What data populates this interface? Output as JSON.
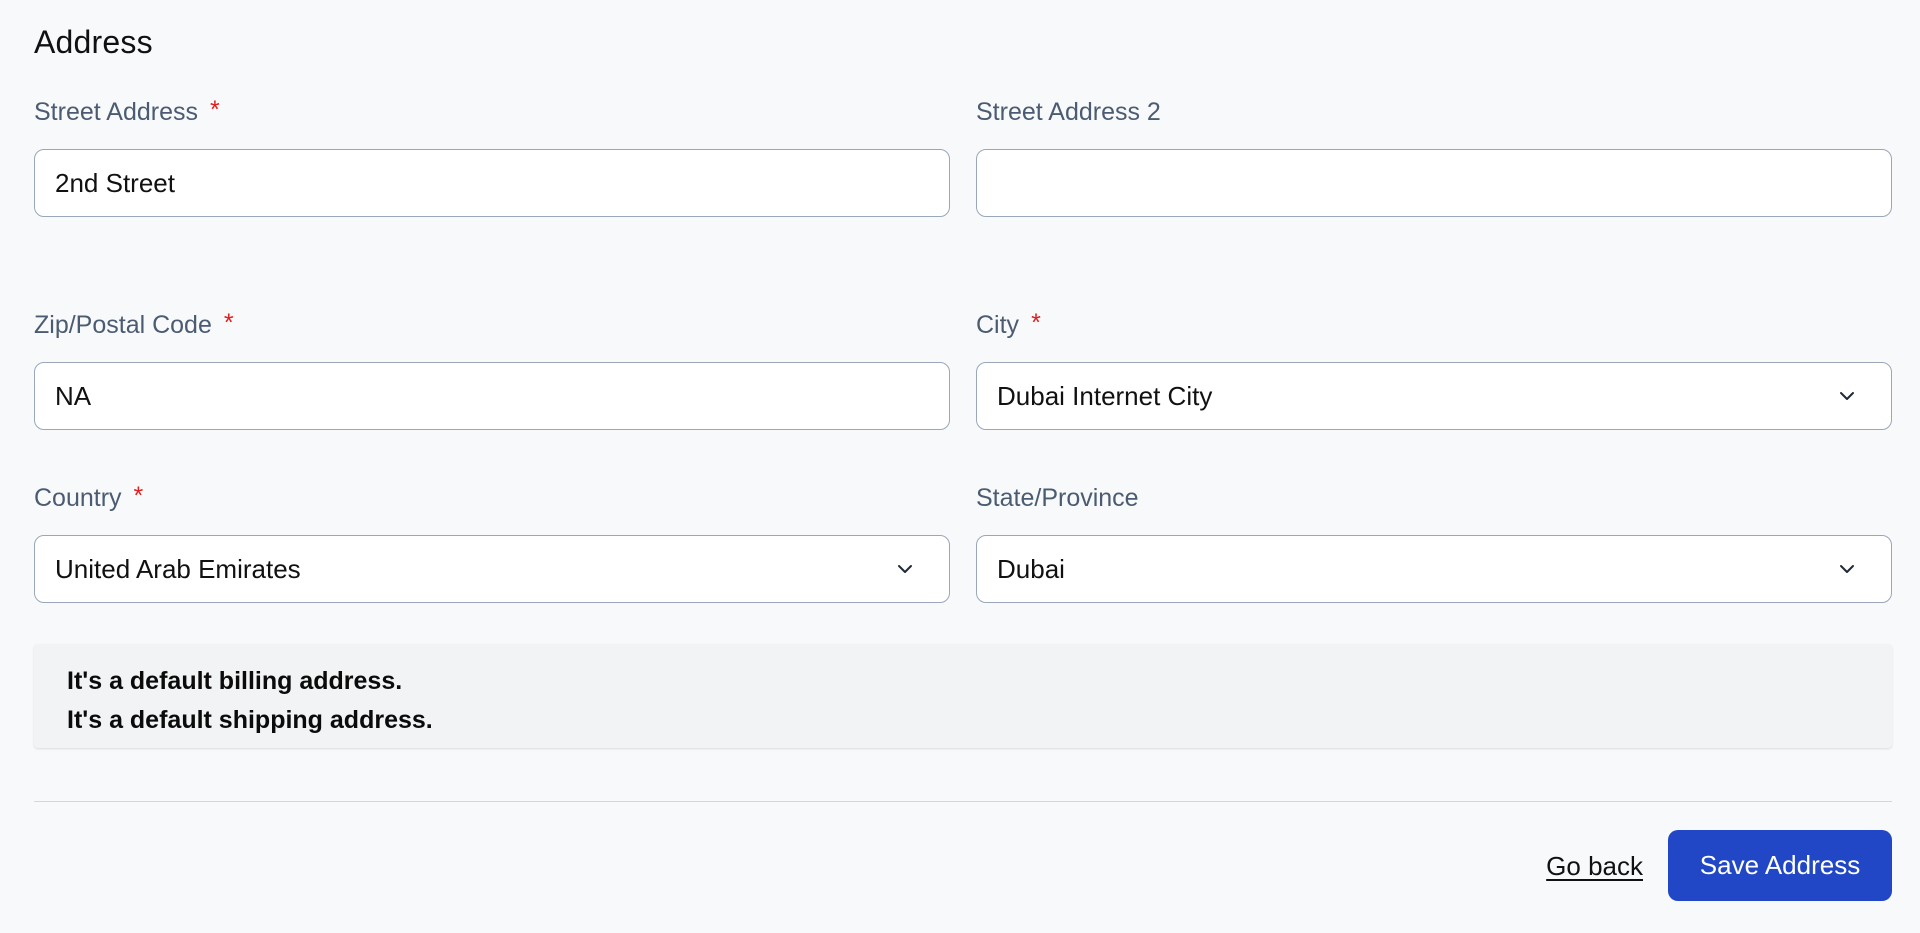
{
  "section": {
    "title": "Address"
  },
  "fields": {
    "street1": {
      "label": "Street Address",
      "required_mark": "*",
      "value": "2nd Street"
    },
    "street2": {
      "label": "Street Address 2",
      "value": ""
    },
    "zip": {
      "label": "Zip/Postal Code",
      "required_mark": "*",
      "value": "NA"
    },
    "city": {
      "label": "City",
      "required_mark": "*",
      "value": "Dubai Internet City",
      "icon": "chevron-down-icon"
    },
    "country": {
      "label": "Country",
      "required_mark": "*",
      "value": "United Arab Emirates",
      "icon": "chevron-down-icon"
    },
    "state": {
      "label": "State/Province",
      "value": "Dubai",
      "icon": "chevron-down-icon"
    }
  },
  "notice": {
    "billing": "It's a default billing address.",
    "shipping": "It's a default shipping address."
  },
  "actions": {
    "go_back": "Go back",
    "save": "Save Address"
  },
  "colors": {
    "accent": "#2147c7",
    "required": "#e11d1d",
    "label": "#4b5c72",
    "background": "#f8f9fb"
  }
}
